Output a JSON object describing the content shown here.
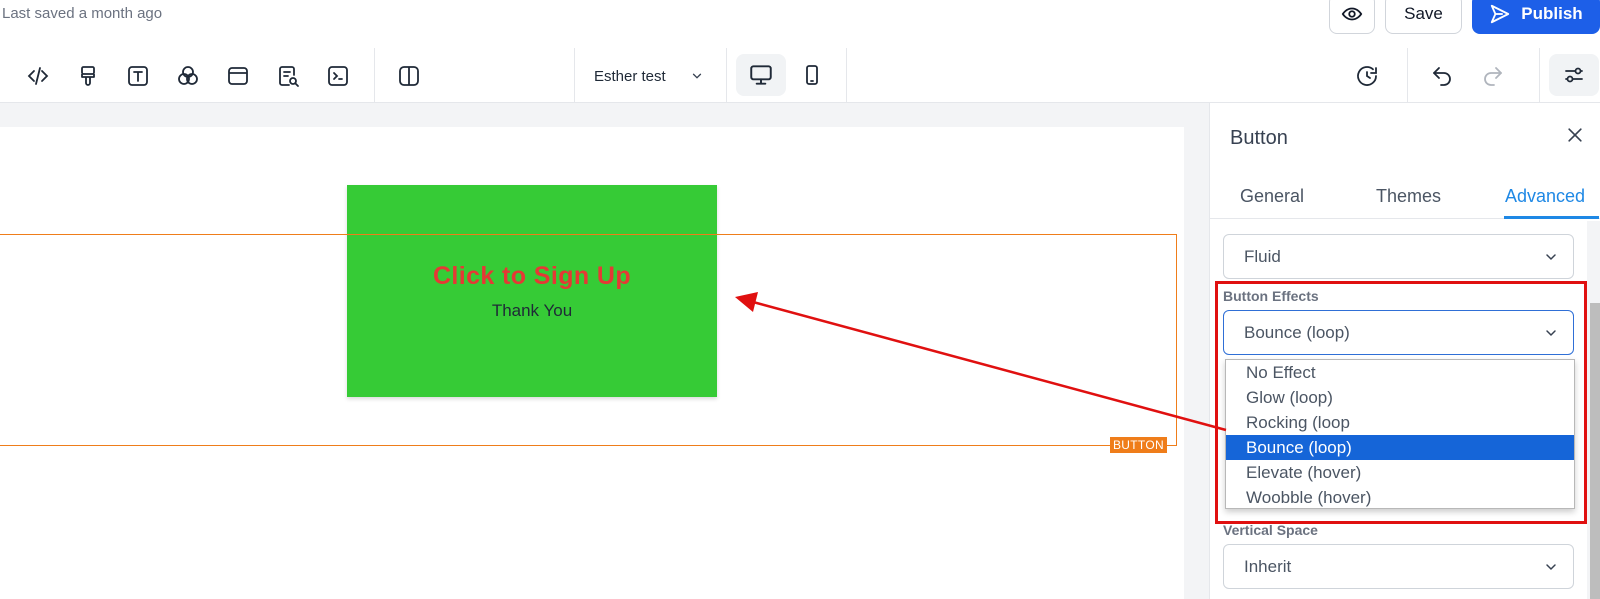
{
  "header": {
    "saved_status": "Last saved a month ago",
    "save_label": "Save",
    "publish_label": "Publish"
  },
  "toolbar": {
    "tools": [
      "code-icon",
      "paint-brush-icon",
      "text-icon",
      "shapes-icon",
      "layout-icon",
      "form-icon",
      "terminal-icon",
      "columns-icon"
    ],
    "page_name": "Esther test",
    "devices": [
      "desktop-icon",
      "mobile-icon"
    ]
  },
  "canvas": {
    "button_title": "Click to Sign Up",
    "button_subtitle": "Thank You",
    "frame_tag": "BUTTON"
  },
  "panel": {
    "title": "Button",
    "tabs": [
      {
        "label": "General",
        "active": false
      },
      {
        "label": "Themes",
        "active": false
      },
      {
        "label": "Advanced",
        "active": true
      }
    ],
    "width_value": "Fluid",
    "effects_label": "Button Effects",
    "effects_value": "Bounce (loop)",
    "effects_options": [
      "No Effect",
      "Glow (loop)",
      "Rocking (loop",
      "Bounce (loop)",
      "Elevate (hover)",
      "Woobble (hover)"
    ],
    "effects_selected_index": 3,
    "vertical_label": "Vertical Space",
    "vertical_value": "Inherit"
  },
  "colors": {
    "accent": "#1e88e5",
    "publish": "#1d5fe8",
    "selection": "#ef7d1a",
    "button_bg": "#36cb36",
    "button_text": "#e53935",
    "annotation": "#e01010"
  }
}
